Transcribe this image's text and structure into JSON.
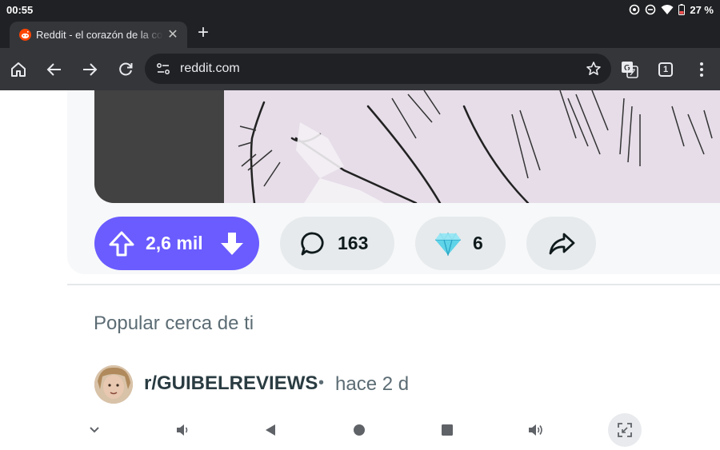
{
  "status_bar": {
    "time": "00:55",
    "battery_percent": "27 %"
  },
  "browser": {
    "tab": {
      "title": "Reddit - el corazón de la co",
      "favicon": "reddit-icon",
      "close_icon": "close-icon"
    },
    "new_tab_icon": "plus-icon",
    "toolbar": {
      "home_icon": "home-icon",
      "back_icon": "back-arrow-icon",
      "forward_icon": "forward-arrow-icon",
      "reload_icon": "reload-icon",
      "url": "reddit.com",
      "bookmark_icon": "star-icon",
      "translate_icon": "translate-icon",
      "tab_count": "1",
      "menu_icon": "more-vert-icon"
    }
  },
  "post": {
    "votes": "2,6 mil",
    "comments": "163",
    "awards": "6",
    "share_icon": "share-icon"
  },
  "feed": {
    "section_title": "Popular cerca de ti",
    "next_post": {
      "subreddit": "r/GUIBELREVIEWS",
      "separator": "•",
      "age": "hace 2 d"
    }
  },
  "nav_bar": {
    "items": [
      "chevron-down-icon",
      "volume-down-icon",
      "back-triangle-icon",
      "home-circle-icon",
      "recents-square-icon",
      "volume-up-icon",
      "rotate-screen-icon"
    ]
  },
  "colors": {
    "vote_accent": "#6a5cff",
    "chrome_dark": "#202124",
    "toolbar": "#35363a"
  }
}
